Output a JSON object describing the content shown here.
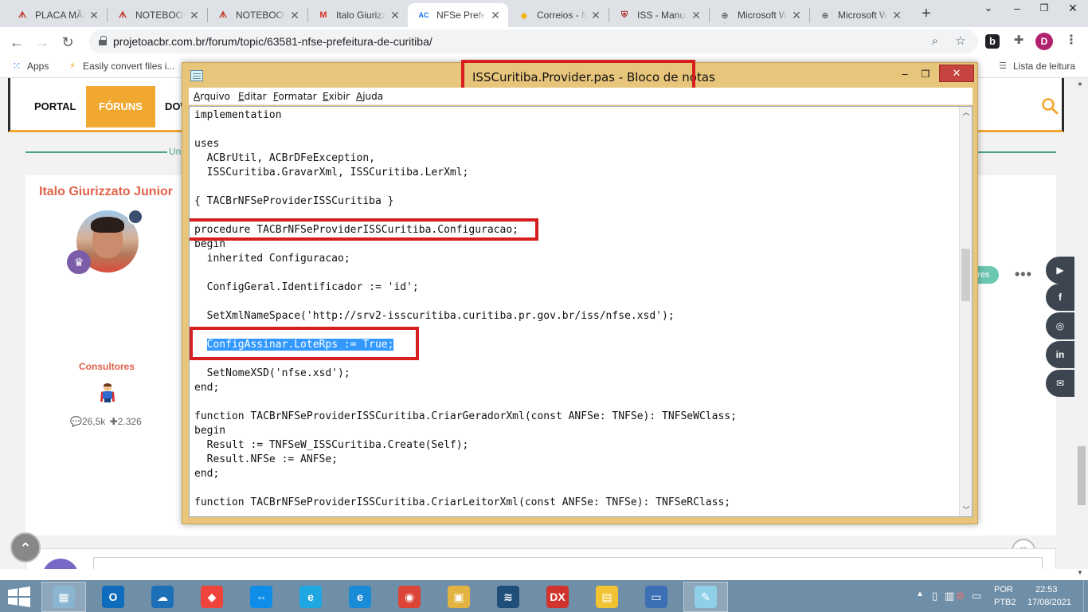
{
  "browser": {
    "tabs": [
      {
        "title": "PLACA MÃE",
        "icon": "acbr-icon",
        "color": "#c0392b"
      },
      {
        "title": "NOTEBOOK",
        "icon": "acbr-icon",
        "color": "#c0392b"
      },
      {
        "title": "NOTEBOOK",
        "icon": "acbr-icon",
        "color": "#c0392b"
      },
      {
        "title": "Italo Giurizzato",
        "icon": "gmail-icon",
        "color": "#d93025"
      },
      {
        "title": "NFSe Prefeitura",
        "icon": "ac-icon",
        "color": "#1a73e8"
      },
      {
        "title": "Correios - M",
        "icon": "correios-icon",
        "color": "#f5b400"
      },
      {
        "title": "ISS - Manual",
        "icon": "crest-icon",
        "color": "#b03030"
      },
      {
        "title": "Microsoft W",
        "icon": "globe-icon",
        "color": "#5f6368"
      },
      {
        "title": "Microsoft W",
        "icon": "globe-icon",
        "color": "#5f6368"
      }
    ],
    "url": "projetoacbr.com.br/forum/topic/63581-nfse-prefeitura-de-curitiba/",
    "profile_initial": "D",
    "bookmarks": {
      "apps": "Apps",
      "convert": "Easily convert files i...",
      "reading_list": "Lista de leitura"
    }
  },
  "site": {
    "nav": [
      "PORTAL",
      "FÓRUNS",
      "DOW"
    ],
    "divider_label": "Un",
    "post": {
      "author": "Italo Giurizzato Junior",
      "rank": "Consultores",
      "posts_count": "26,5k",
      "reputation": "2.326",
      "group_pill": "res"
    },
    "social": [
      "youtube",
      "facebook",
      "instagram",
      "linkedin",
      "email"
    ]
  },
  "notepad": {
    "title": "ISSCuritiba.Provider.pas - Bloco de notas",
    "menu": [
      {
        "first": "A",
        "rest": "rquivo"
      },
      {
        "first": "E",
        "rest": "ditar"
      },
      {
        "first": "F",
        "rest": "ormatar"
      },
      {
        "first": "E",
        "rest": "xibir"
      },
      {
        "first": "A",
        "rest": "juda"
      }
    ],
    "lines": [
      "implementation",
      "",
      "uses",
      "  ACBrUtil, ACBrDFeException,",
      "  ISSCuritiba.GravarXml, ISSCuritiba.LerXml;",
      "",
      "{ TACBrNFSeProviderISSCuritiba }",
      "",
      "procedure TACBrNFSeProviderISSCuritiba.Configuracao;",
      "begin",
      "  inherited Configuracao;",
      "",
      "  ConfigGeral.Identificador := 'id';",
      "",
      "  SetXmlNameSpace('http://srv2-isscuritiba.curitiba.pr.gov.br/iss/nfse.xsd');",
      "",
      "  ConfigAssinar.LoteRps := True;",
      "",
      "  SetNomeXSD('nfse.xsd');",
      "end;",
      "",
      "function TACBrNFSeProviderISSCuritiba.CriarGeradorXml(const ANFSe: TNFSe): TNFSeWClass;",
      "begin",
      "  Result := TNFSeW_ISSCuritiba.Create(Self);",
      "  Result.NFSe := ANFSe;",
      "end;",
      "",
      "function TACBrNFSeProviderISSCuritiba.CriarLeitorXml(const ANFSe: TNFSe): TNFSeRClass;"
    ],
    "selected_line": 16,
    "selected_text": "ConfigAssinar.LoteRps := True;"
  },
  "taskbar": {
    "apps": [
      {
        "name": "explorer-app",
        "glyph": "▦",
        "color": "#8ab4d0",
        "open": true
      },
      {
        "name": "outlook-app",
        "glyph": "O",
        "color": "#0f6cbd",
        "open": false
      },
      {
        "name": "cloud-app",
        "glyph": "☁",
        "color": "#1d70b8",
        "open": false
      },
      {
        "name": "anydesk-app",
        "glyph": "◆",
        "color": "#ef443b",
        "open": false
      },
      {
        "name": "teamviewer-app",
        "glyph": "⇔",
        "color": "#0e8ee9",
        "open": false
      },
      {
        "name": "ie-app",
        "glyph": "e",
        "color": "#1ea7e1",
        "open": false
      },
      {
        "name": "edge-app",
        "glyph": "e",
        "color": "#1a8bd6",
        "open": false
      },
      {
        "name": "chrome-app",
        "glyph": "◉",
        "color": "#db4437",
        "open": false
      },
      {
        "name": "folder-tools-app",
        "glyph": "▣",
        "color": "#e3b341",
        "open": false
      },
      {
        "name": "mysql-app",
        "glyph": "≋",
        "color": "#1f4e79",
        "open": false
      },
      {
        "name": "devexpress-app",
        "glyph": "DX",
        "color": "#d0342c",
        "open": false
      },
      {
        "name": "file-explorer-app",
        "glyph": "▤",
        "color": "#f1c232",
        "open": false
      },
      {
        "name": "remote-desktop-app",
        "glyph": "▭",
        "color": "#3c6fb4",
        "open": false
      },
      {
        "name": "notepad-app",
        "glyph": "✎",
        "color": "#8fd0e8",
        "open": true
      }
    ],
    "language": "POR",
    "keyboard": "PTB2",
    "time": "22:53",
    "date": "17/08/2021"
  }
}
